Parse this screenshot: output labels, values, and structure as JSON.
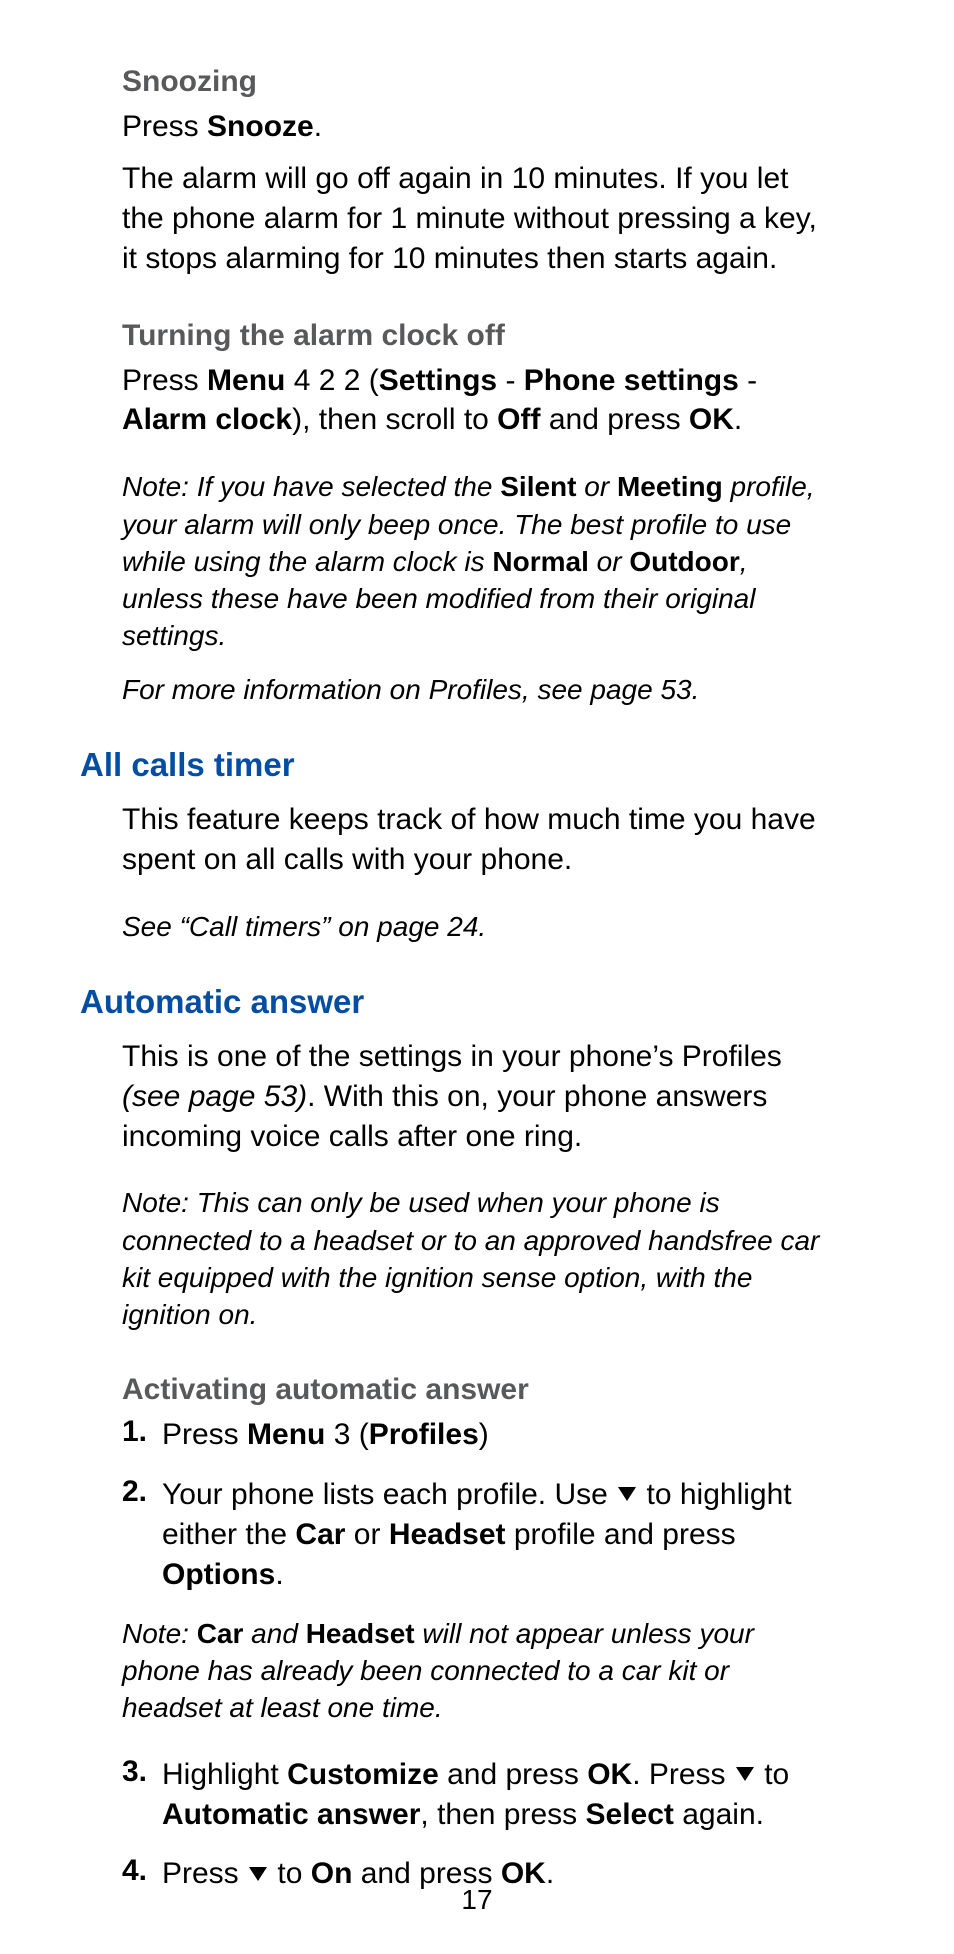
{
  "sec1": {
    "h": "Snoozing",
    "p1a": "Press ",
    "p1b": "Snooze",
    "p1c": ".",
    "p2": "The alarm will go off again in 10 minutes. If you let the phone alarm for 1 minute without pressing a key, it stops alarming for 10 minutes then starts again."
  },
  "sec2": {
    "h": "Turning the alarm clock off",
    "p1_a": "Press ",
    "p1_b": "Menu",
    "p1_c": " 4 2 2 (",
    "p1_d": "Settings",
    "p1_e": " - ",
    "p1_f": "Phone settings",
    "p1_g": " - ",
    "p1_h": "Alarm clock",
    "p1_i": "), then scroll to ",
    "p1_j": "Off",
    "p1_k": " and press ",
    "p1_l": "OK",
    "p1_m": ".",
    "n1_a": "Note: If you have selected the ",
    "n1_b": "Silent",
    "n1_c": " or ",
    "n1_d": "Meeting",
    "n1_e": " profile, your alarm will only beep once. The best profile to use while using the alarm clock is ",
    "n1_f": "Normal",
    "n1_g": " or ",
    "n1_h": "Outdoor",
    "n1_i": ", unless these have been modified from their original settings.",
    "n2": "For more information on Profiles, see page 53."
  },
  "sec3": {
    "h": "All calls timer",
    "p1": "This feature keeps track of how much time you have spent on all calls with your phone.",
    "n1": "See “Call timers” on page 24."
  },
  "sec4": {
    "h": "Automatic answer",
    "p1_a": "This is one of the settings in your phone’s Profiles ",
    "p1_b": "(see page 53)",
    "p1_c": ". With this on, your phone answers incoming voice calls after one ring.",
    "n1": "Note: This can only be used when your phone is connected to a headset or to an approved handsfree car kit equipped with the ignition sense option, with the ignition on."
  },
  "sec5": {
    "h": "Activating automatic answer",
    "li1_num": "1.",
    "li1_a": "Press ",
    "li1_b": "Menu",
    "li1_c": " 3 (",
    "li1_d": "Profiles",
    "li1_e": ")",
    "li2_num": "2.",
    "li2_a": "Your phone lists each profile. Use ",
    "li2_b": " to highlight either the ",
    "li2_c": "Car",
    "li2_d": " or ",
    "li2_e": "Headset",
    "li2_f": " profile and press ",
    "li2_g": "Options",
    "li2_h": ".",
    "note_a": "Note: ",
    "note_b": "Car",
    "note_c": " and ",
    "note_d": "Headset",
    "note_e": " will not appear unless your phone has already been connected to a car kit or headset at least one time.",
    "li3_num": "3.",
    "li3_a": "Highlight ",
    "li3_b": "Customize",
    "li3_c": " and press ",
    "li3_d": "OK",
    "li3_e": ". Press ",
    "li3_f": " to ",
    "li3_g": "Automatic answer",
    "li3_h": ", then press ",
    "li3_i": "Select",
    "li3_j": " again.",
    "li4_num": "4.",
    "li4_a": "Press ",
    "li4_b": " to ",
    "li4_c": "On",
    "li4_d": " and press ",
    "li4_e": "OK",
    "li4_f": "."
  },
  "pagenum": "17"
}
